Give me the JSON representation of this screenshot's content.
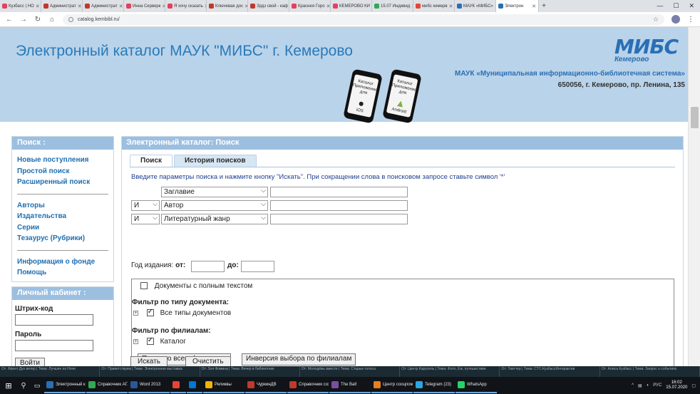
{
  "browser": {
    "tabs": [
      {
        "label": "Кузбасс | НО",
        "color": "#e4405f"
      },
      {
        "label": "Администрат",
        "color": "#c0392b"
      },
      {
        "label": "Администрат",
        "color": "#c0392b"
      },
      {
        "label": "Инна Серверк",
        "color": "#e4405f"
      },
      {
        "label": "Я хочу сказать",
        "color": "#e4405f"
      },
      {
        "label": "Ключевая дос",
        "color": "#c0392b"
      },
      {
        "label": "Зрдз свой - каф",
        "color": "#c0392b"
      },
      {
        "label": "Краснея Горо",
        "color": "#e4405f"
      },
      {
        "label": "КЕМЕРОВО КИ",
        "color": "#e4405f"
      },
      {
        "label": "15.07 Индивид",
        "color": "#34a853"
      },
      {
        "label": "мибс кемерв",
        "color": "#ea4335"
      },
      {
        "label": "МАУК «МИБС»",
        "color": "#2a6fb4"
      }
    ],
    "active_tab": {
      "label": "Электрон",
      "color": "#2a6fb4"
    },
    "new_tab": "+",
    "window_controls": [
      "—",
      "☐",
      "✕"
    ],
    "url": "catalog.kembibl.ru/"
  },
  "header": {
    "title": "Электронный каталог МАУК \"МИБС\" г. Кемерово",
    "logo_text": "МИБС",
    "logo_sub": "Кемерово",
    "org_name": "МАУК «Муниципальная информационно-библиотечная система»",
    "org_address": "650056, г. Кемерово, пр. Ленина, 135",
    "phone_ios": {
      "line1": "Каталог",
      "line2": "Приложение",
      "line3": "для",
      "os": "iOS"
    },
    "phone_android": {
      "line1": "Каталог",
      "line2": "Приложение",
      "line3": "для",
      "os": "Android"
    }
  },
  "sidebar": {
    "search_title": "Поиск :",
    "links_group1": [
      "Новые поступления",
      "Простой поиск",
      "Расширенный поиск"
    ],
    "links_group2": [
      "Авторы",
      "Издательства",
      "Серии",
      "Тезаурус (Рубрики)"
    ],
    "links_group3": [
      "Информация о фонде",
      "Помощь"
    ],
    "cabinet_title": "Личный кабинет :",
    "barcode_label": "Штрих-код",
    "password_label": "Пароль",
    "login_button": "Войти"
  },
  "main": {
    "panel_title": "Электронный каталог: Поиск",
    "tab_search": "Поиск",
    "tab_history": "История поисков",
    "hint": "Введите параметры поиска и нажмите кнопку \"Искать\". При сокращении слова в поисковом запросе ставьте символ '*'",
    "rows": [
      {
        "op": "",
        "field": "Заглавие",
        "value": ""
      },
      {
        "op": "И",
        "field": "Автор",
        "value": ""
      },
      {
        "op": "И",
        "field": "Литературный жанр",
        "value": ""
      }
    ],
    "year_label": "Год издания:",
    "year_from": "от:",
    "year_to": "до:",
    "fulltext_label": "Документы с полным текстом",
    "doc_filter_title": "Фильтр по типу документа:",
    "doc_all": "Все типы документов",
    "branch_filter_title": "Фильтр по филиалам:",
    "branch_catalog": "Каталог",
    "btn_all_branches": "Поиск по всем филиалам",
    "btn_invert_branches": "Инверсия выбора по филиалам",
    "btn_search": "Искать",
    "btn_clear": "Очистить"
  },
  "mail_thumbs": [
    "От: Фронт Дух ветер | Тема: Лучшее из Ночи",
    "От: Приветствуем | Тема: Электронная выставка",
    "От: Зоя Фомина | Тема: Вечер в библиотеке",
    "От: Молодёжь вместе | Тема: Старые голоса",
    "От: Центр Карусель | Тема: Фото, Ёж, путешествие",
    "От: Твиттер | Тема: СТС-КузбассИнтерактив",
    "От: Алиса Кузбасс | Тема: Запрос о событиях"
  ],
  "taskbar": {
    "apps": [
      {
        "label": "Электронный к...",
        "color": "#2a6fb4"
      },
      {
        "label": "Справочник АГ...",
        "color": "#34a853"
      },
      {
        "label": "Word 2013",
        "color": "#2b579a"
      },
      {
        "label": "",
        "color": "#ea4335"
      },
      {
        "label": "",
        "color": "#0078d4"
      },
      {
        "label": "Реликвы",
        "color": "#f0b400"
      },
      {
        "label": "ЧуркинДВ",
        "color": "#c0392b"
      },
      {
        "label": "Справочник сох...",
        "color": "#c0392b"
      },
      {
        "label": "The Bat!",
        "color": "#7b4fa0"
      },
      {
        "label": "Центр сооцпом...",
        "color": "#e67e22"
      },
      {
        "label": "Telegram (23)",
        "color": "#2ca5e0"
      },
      {
        "label": "WhatsApp",
        "color": "#25d366"
      }
    ],
    "lang": "РУС",
    "time": "16:02",
    "date": "15.07.2020"
  }
}
